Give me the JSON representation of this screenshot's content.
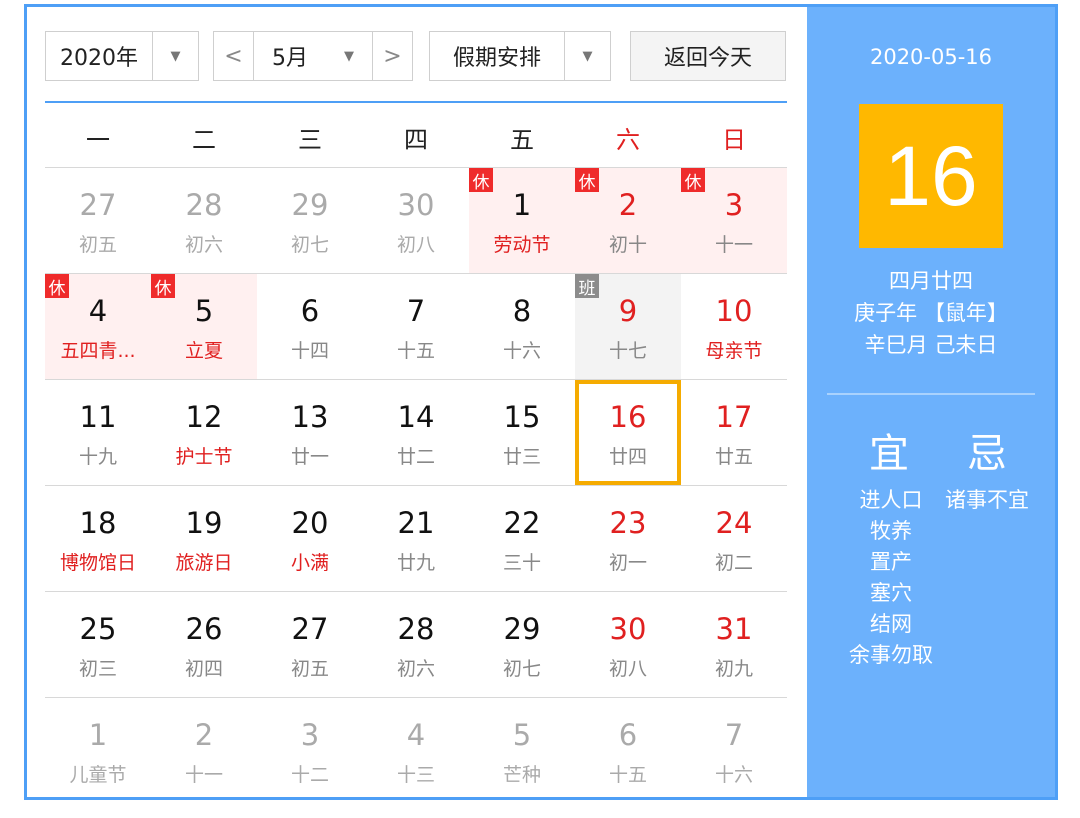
{
  "toolbar": {
    "year_label": "2020年",
    "month_label": "5月",
    "holiday_label": "假期安排",
    "today_label": "返回今天",
    "prev_glyph": "<",
    "next_glyph": ">",
    "dropdown_glyph": "▼"
  },
  "weekdays": [
    "一",
    "二",
    "三",
    "四",
    "五",
    "六",
    "日"
  ],
  "weeks": [
    [
      {
        "day": "27",
        "lunar": "初五",
        "other": true
      },
      {
        "day": "28",
        "lunar": "初六",
        "other": true
      },
      {
        "day": "29",
        "lunar": "初七",
        "other": true
      },
      {
        "day": "30",
        "lunar": "初八",
        "other": true
      },
      {
        "day": "1",
        "lunar": "劳动节",
        "badge": "休",
        "festival": true
      },
      {
        "day": "2",
        "lunar": "初十",
        "badge": "休"
      },
      {
        "day": "3",
        "lunar": "十一",
        "badge": "休"
      }
    ],
    [
      {
        "day": "4",
        "lunar": "五四青...",
        "badge": "休",
        "festival": true
      },
      {
        "day": "5",
        "lunar": "立夏",
        "badge": "休",
        "festival": true
      },
      {
        "day": "6",
        "lunar": "十四"
      },
      {
        "day": "7",
        "lunar": "十五"
      },
      {
        "day": "8",
        "lunar": "十六"
      },
      {
        "day": "9",
        "lunar": "十七",
        "badge": "班"
      },
      {
        "day": "10",
        "lunar": "母亲节",
        "festival": true
      }
    ],
    [
      {
        "day": "11",
        "lunar": "十九"
      },
      {
        "day": "12",
        "lunar": "护士节",
        "festival": true
      },
      {
        "day": "13",
        "lunar": "廿一"
      },
      {
        "day": "14",
        "lunar": "廿二"
      },
      {
        "day": "15",
        "lunar": "廿三"
      },
      {
        "day": "16",
        "lunar": "廿四",
        "selected": true
      },
      {
        "day": "17",
        "lunar": "廿五"
      }
    ],
    [
      {
        "day": "18",
        "lunar": "博物馆日",
        "festival": true
      },
      {
        "day": "19",
        "lunar": "旅游日",
        "festival": true
      },
      {
        "day": "20",
        "lunar": "小满",
        "festival": true
      },
      {
        "day": "21",
        "lunar": "廿九"
      },
      {
        "day": "22",
        "lunar": "三十"
      },
      {
        "day": "23",
        "lunar": "初一"
      },
      {
        "day": "24",
        "lunar": "初二"
      }
    ],
    [
      {
        "day": "25",
        "lunar": "初三"
      },
      {
        "day": "26",
        "lunar": "初四"
      },
      {
        "day": "27",
        "lunar": "初五"
      },
      {
        "day": "28",
        "lunar": "初六"
      },
      {
        "day": "29",
        "lunar": "初七"
      },
      {
        "day": "30",
        "lunar": "初八"
      },
      {
        "day": "31",
        "lunar": "初九"
      }
    ],
    [
      {
        "day": "1",
        "lunar": "儿童节",
        "other": true
      },
      {
        "day": "2",
        "lunar": "十一",
        "other": true
      },
      {
        "day": "3",
        "lunar": "十二",
        "other": true
      },
      {
        "day": "4",
        "lunar": "十三",
        "other": true
      },
      {
        "day": "5",
        "lunar": "芒种",
        "other": true
      },
      {
        "day": "6",
        "lunar": "十五",
        "other": true
      },
      {
        "day": "7",
        "lunar": "十六",
        "other": true
      }
    ]
  ],
  "panel": {
    "date": "2020-05-16",
    "big_day": "16",
    "lunar_date": "四月廿四",
    "year_ganzhi": "庚子年 【鼠年】",
    "month_day_ganzhi": "辛巳月 己未日",
    "yi_label": "宜",
    "ji_label": "忌",
    "yi_items": [
      "进人口",
      "牧养",
      "置产",
      "塞穴",
      "结网",
      "余事勿取"
    ],
    "ji_items": [
      "诸事不宜"
    ]
  },
  "colors": {
    "accent_blue": "#4e9ff6",
    "panel_blue": "#6cb1fc",
    "highlight_yellow": "#ffb800",
    "holiday_red": "#e02020",
    "rest_badge": "#ef2b2b",
    "work_badge": "#8c8c8c"
  }
}
